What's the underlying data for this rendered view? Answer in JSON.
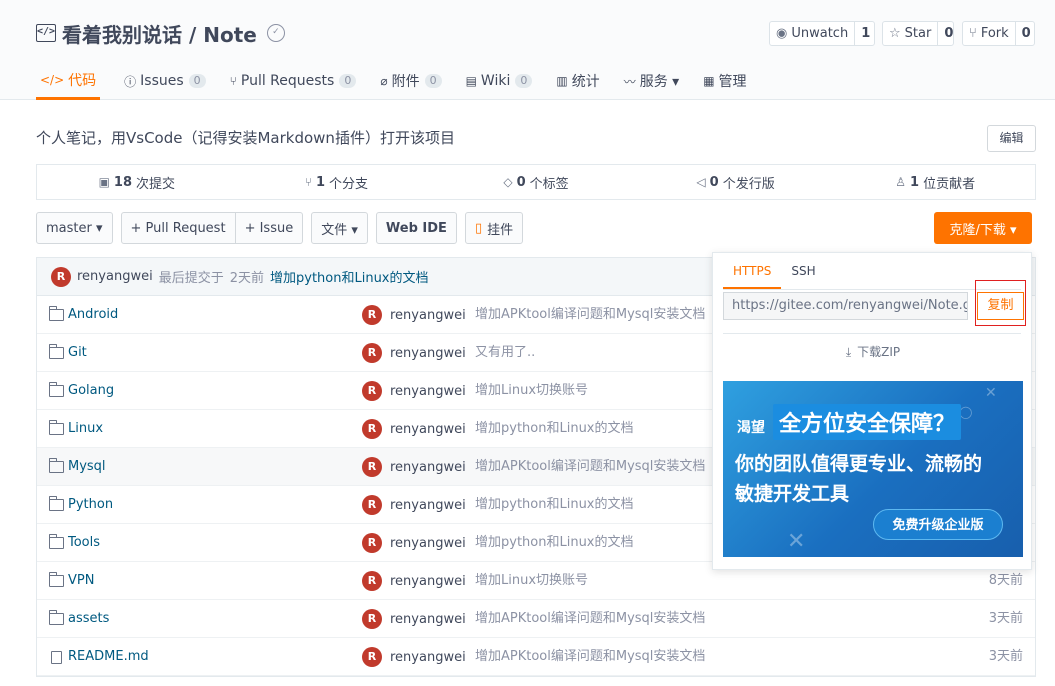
{
  "repo": {
    "title": "看着我别说话 / Note"
  },
  "actions": [
    {
      "icon": "eye-icon",
      "glyph": "◉",
      "label": "Unwatch",
      "count": "1"
    },
    {
      "icon": "star-icon",
      "glyph": "☆",
      "label": "Star",
      "count": "0"
    },
    {
      "icon": "fork-icon",
      "glyph": "⑂",
      "label": "Fork",
      "count": "0"
    }
  ],
  "tabs": [
    {
      "icon": "code-icon",
      "glyph": "</>",
      "label": "代码",
      "count": null,
      "active": true
    },
    {
      "icon": "issues-icon",
      "glyph": "ⓘ",
      "label": "Issues",
      "count": "0"
    },
    {
      "icon": "pull-request-icon",
      "glyph": "⑂",
      "label": "Pull Requests",
      "count": "0"
    },
    {
      "icon": "attachment-icon",
      "glyph": "⌀",
      "label": "附件",
      "count": "0"
    },
    {
      "icon": "wiki-icon",
      "glyph": "▤",
      "label": "Wiki",
      "count": "0"
    },
    {
      "icon": "stats-icon",
      "glyph": "▥",
      "label": "统计",
      "count": null
    },
    {
      "icon": "service-icon",
      "glyph": "〰",
      "label": "服务 ▾",
      "count": null
    },
    {
      "icon": "manage-icon",
      "glyph": "▦",
      "label": "管理",
      "count": null
    }
  ],
  "description": "个人笔记，用VsCode（记得安装Markdown插件）打开该项目",
  "edit_label": "编辑",
  "stats": [
    {
      "icon": "commit-icon",
      "glyph": "▣",
      "num": "18",
      "label": "次提交"
    },
    {
      "icon": "branch-icon",
      "glyph": "⑂",
      "num": "1",
      "label": "个分支"
    },
    {
      "icon": "tag-icon",
      "glyph": "◇",
      "num": "0",
      "label": "个标签"
    },
    {
      "icon": "release-icon",
      "glyph": "◁",
      "num": "0",
      "label": "个发行版"
    },
    {
      "icon": "contributors-icon",
      "glyph": "♙",
      "num": "1",
      "label": "位贡献者"
    }
  ],
  "toolbar": {
    "branch": "master ▾",
    "pull_request": "+ Pull Request",
    "issue": "+ Issue",
    "file": "文件 ▾",
    "web_ide": "Web IDE",
    "widget": "挂件"
  },
  "clone_label": "克隆/下载 ▾",
  "commit": {
    "avatar": "R",
    "author": "renyangwei",
    "text": "最后提交于",
    "time": "2天前",
    "message": "增加python和Linux的文档"
  },
  "files": [
    {
      "name": "Android",
      "type": "folder",
      "author": "renyangwei",
      "msg": "增加APKtool编译问题和Mysql安装文档",
      "time": ""
    },
    {
      "name": "Git",
      "type": "folder",
      "author": "renyangwei",
      "msg": "又有用了..",
      "time": ""
    },
    {
      "name": "Golang",
      "type": "folder",
      "author": "renyangwei",
      "msg": "增加Linux切换账号",
      "time": ""
    },
    {
      "name": "Linux",
      "type": "folder",
      "author": "renyangwei",
      "msg": "增加python和Linux的文档",
      "time": ""
    },
    {
      "name": "Mysql",
      "type": "folder",
      "author": "renyangwei",
      "msg": "增加APKtool编译问题和Mysql安装文档",
      "time": ""
    },
    {
      "name": "Python",
      "type": "folder",
      "author": "renyangwei",
      "msg": "增加python和Linux的文档",
      "time": ""
    },
    {
      "name": "Tools",
      "type": "folder",
      "author": "renyangwei",
      "msg": "增加python和Linux的文档",
      "time": ""
    },
    {
      "name": "VPN",
      "type": "folder",
      "author": "renyangwei",
      "msg": "增加Linux切换账号",
      "time": "8天前"
    },
    {
      "name": "assets",
      "type": "folder",
      "author": "renyangwei",
      "msg": "增加APKtool编译问题和Mysql安装文档",
      "time": "3天前"
    },
    {
      "name": "README.md",
      "type": "file",
      "author": "renyangwei",
      "msg": "增加APKtool编译问题和Mysql安装文档",
      "time": "3天前"
    }
  ],
  "clone_popup": {
    "tab_https": "HTTPS",
    "tab_ssh": "SSH",
    "url": "https://gitee.com/renyangwei/Note.git",
    "copy_label": "复制",
    "download_zip": "下载ZIP"
  },
  "ad": {
    "small": "渴望",
    "highlight": "全方位安全保障？",
    "line2": "你的团队值得更专业、流畅的",
    "line3": "敏捷开发工具",
    "cta": "免费升级企业版"
  },
  "colors": {
    "accent": "#fe7300",
    "link": "#005980",
    "avatar": "#c13a2c"
  }
}
